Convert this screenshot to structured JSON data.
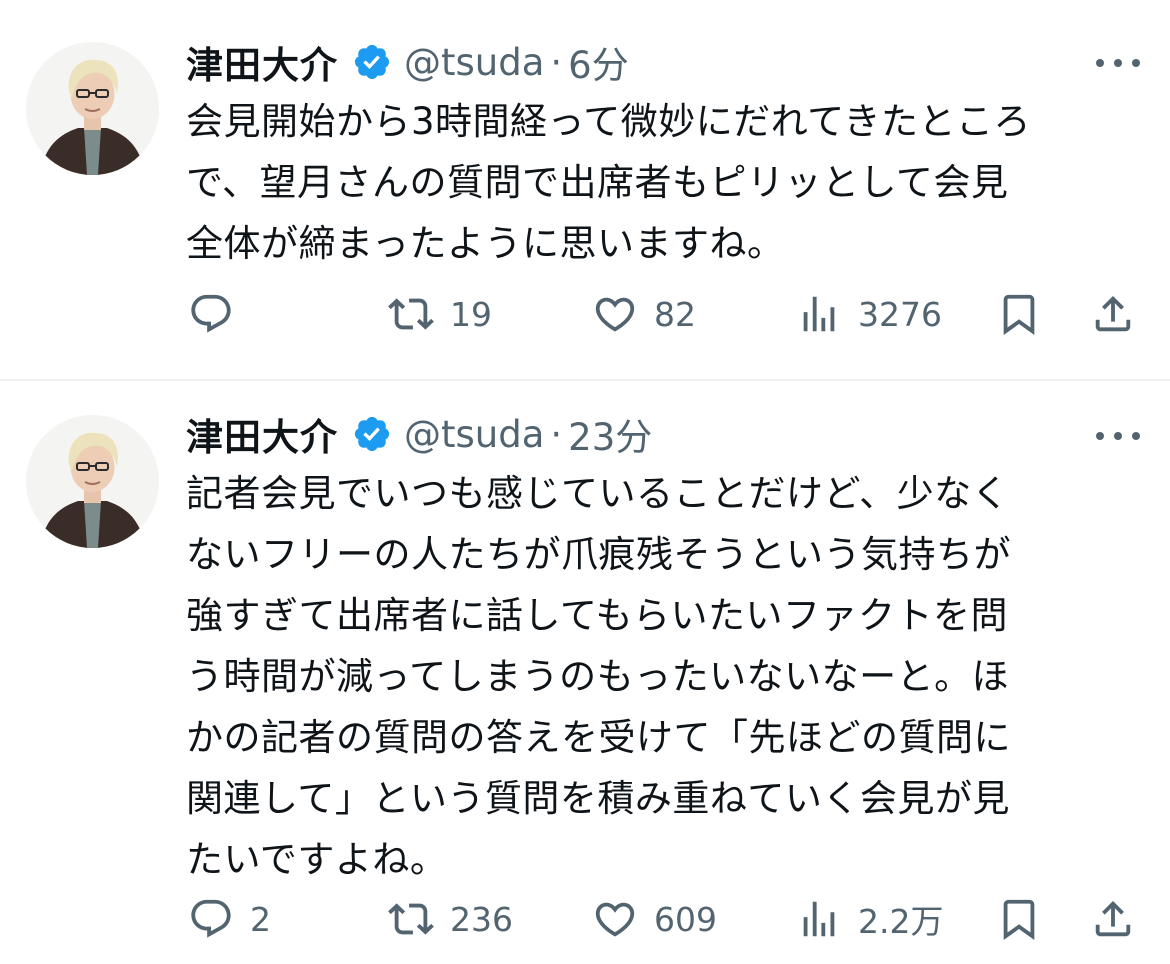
{
  "tweets": [
    {
      "author": {
        "display_name": "津田大介",
        "handle": "@tsuda"
      },
      "separator": "·",
      "time": "6分",
      "text": "会見開始から3時間経って微妙にだれてきたところ\nで、望月さんの質問で出席者もピリッとして会見\n全体が締まったように思いますね。",
      "stats": {
        "replies": "",
        "retweets": "19",
        "likes": "82",
        "views": "3276"
      }
    },
    {
      "author": {
        "display_name": "津田大介",
        "handle": "@tsuda"
      },
      "separator": "·",
      "time": "23分",
      "text": "記者会見でいつも感じていることだけど、少なく\nないフリーの人たちが爪痕残そうという気持ちが\n強すぎて出席者に話してもらいたいファクトを問\nう時間が減ってしまうのもったいないなーと。ほ\nかの記者の質問の答えを受けて「先ほどの質問に\n関連して」という質問を積み重ねていく会見が見\nたいですよね。",
      "stats": {
        "replies": "2",
        "retweets": "236",
        "likes": "609",
        "views": "2.2万"
      }
    }
  ],
  "icons": {
    "verified": "verified-badge-icon",
    "more": "more-icon",
    "reply": "reply-icon",
    "retweet": "retweet-icon",
    "like": "heart-icon",
    "views": "views-icon",
    "bookmark": "bookmark-icon",
    "share": "share-icon"
  },
  "colors": {
    "text": "#0f1419",
    "secondary": "#536471",
    "verified": "#1d9bf0",
    "divider": "#eff3f4"
  }
}
